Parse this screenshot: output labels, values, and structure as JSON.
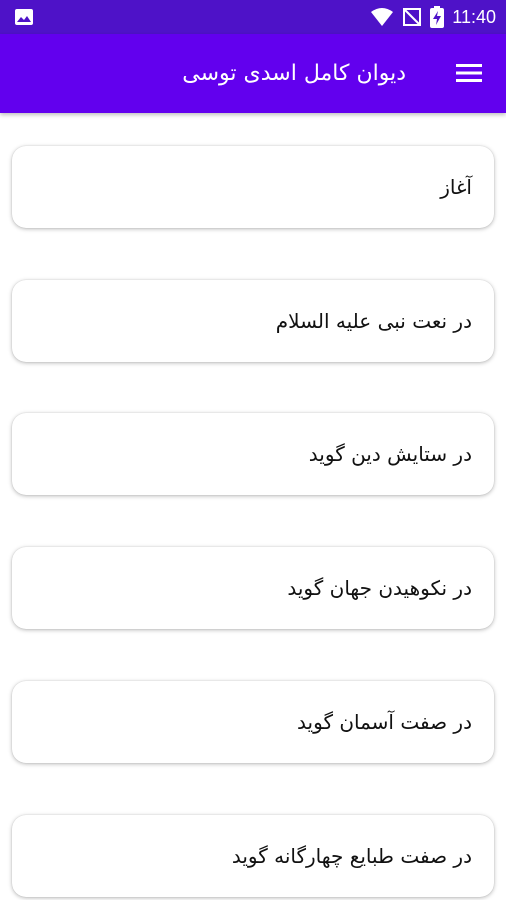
{
  "status_bar": {
    "time": "11:40",
    "icons": [
      "image-icon",
      "wifi-icon",
      "no-signal-icon",
      "battery-charging-icon"
    ]
  },
  "app_bar": {
    "title": "دیوان کامل اسدی توسی",
    "menu_icon": "hamburger-menu-icon",
    "background": "#6200ee"
  },
  "list": {
    "items": [
      {
        "label": "آغاز"
      },
      {
        "label": "در نعت نبی علیه السلام"
      },
      {
        "label": "در ستایش دین گوید"
      },
      {
        "label": "در نکوهیدن جهان گوید"
      },
      {
        "label": "در صفت آسمان گوید"
      },
      {
        "label": "در صفت طبایع چهارگانه گوید"
      }
    ]
  }
}
